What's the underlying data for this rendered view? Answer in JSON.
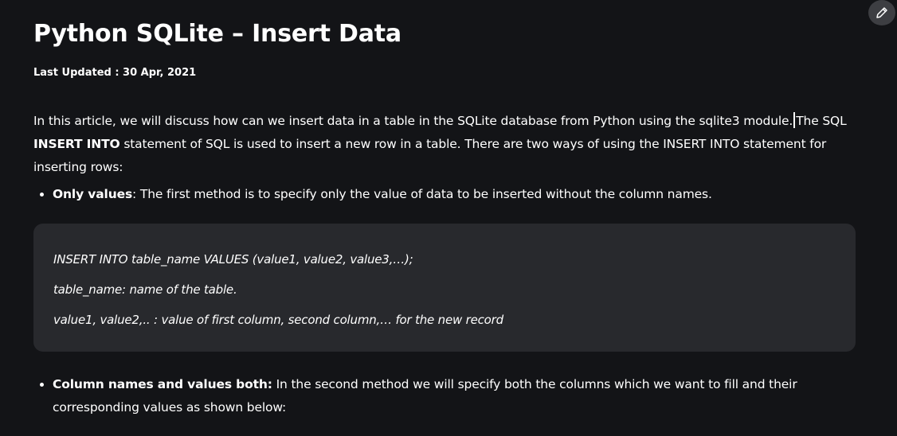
{
  "article": {
    "title": "Python SQLite – Insert Data",
    "last_updated": "Last Updated : 30 Apr, 2021",
    "intro_part1": "In this article, we will discuss how can we insert data in a table in the SQLite database from Python using the sqlite3 module.",
    "intro_part2": "The SQL ",
    "intro_bold": "INSERT INTO",
    "intro_part3": " statement of SQL is used to insert a new row in a table. There are two ways of using the INSERT INTO statement for inserting rows:"
  },
  "method1": {
    "label": "Only values",
    "text": ": The first method is to specify only the value of data to be inserted without the column names."
  },
  "code_block": {
    "lines": [
      "INSERT INTO table_name VALUES (value1, value2, value3,…);",
      "table_name: name of the table.",
      "value1, value2,.. : value of first column, second column,… for the new record"
    ]
  },
  "method2": {
    "label": "Column names and values both:",
    "text": " In the second method we will specify both the columns which we want to fill and their corresponding values as shown below:"
  },
  "toolbar": {
    "edit_icon": "pencil-icon"
  },
  "colors": {
    "background": "#131417",
    "code_background": "#28292d",
    "edit_button": "#3d3e42",
    "text": "#ffffff"
  }
}
